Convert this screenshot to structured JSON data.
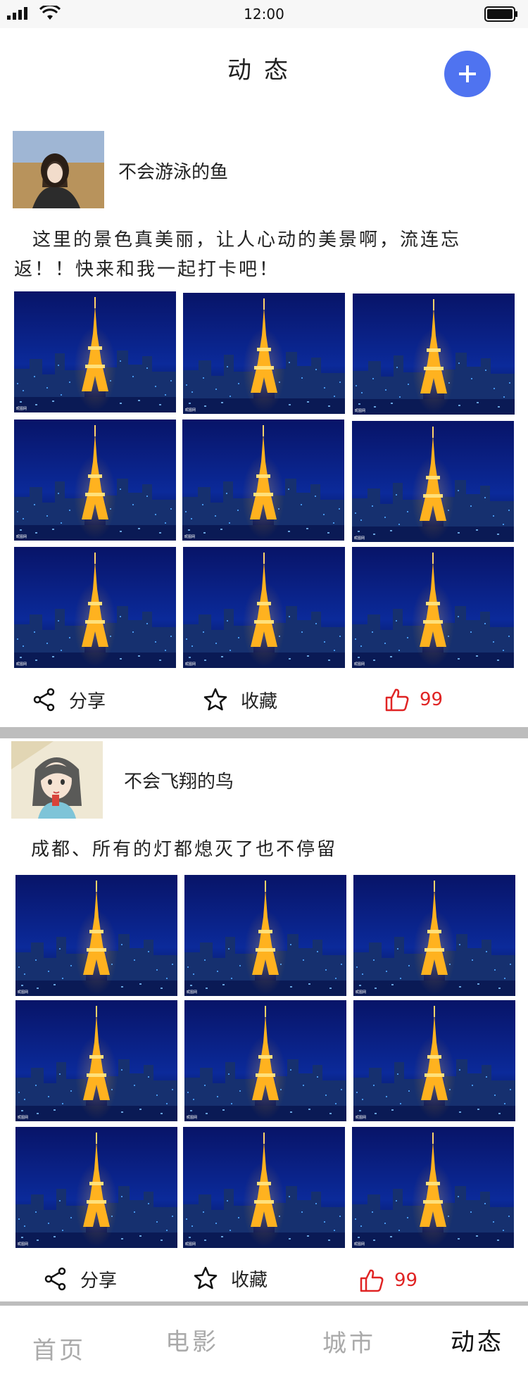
{
  "status_bar": {
    "time": "12:00"
  },
  "header": {
    "title": "动态",
    "add_icon": "plus-icon",
    "accent": "#4f73f0"
  },
  "posts": [
    {
      "username": "不会游泳的鱼",
      "text_line1": "这里的景色真美丽，让人心动的美景啊，流连忘",
      "text_line2": "返！！快来和我一起打卡吧！",
      "share_label": "分享",
      "favorite_label": "收藏",
      "like_count": "99"
    },
    {
      "username": "不会飞翔的鸟",
      "text_line1": "成都、所有的灯都熄灭了也不停留",
      "share_label": "分享",
      "favorite_label": "收藏",
      "like_count": "99"
    }
  ],
  "tabs": [
    {
      "label": "首页",
      "active": false
    },
    {
      "label": "电影",
      "active": false
    },
    {
      "label": "城市",
      "active": false
    },
    {
      "label": "动态",
      "active": true
    }
  ],
  "colors": {
    "like": "#e02424",
    "divider": "#bdbdbd",
    "inactive_tab": "#aaaaaa"
  }
}
